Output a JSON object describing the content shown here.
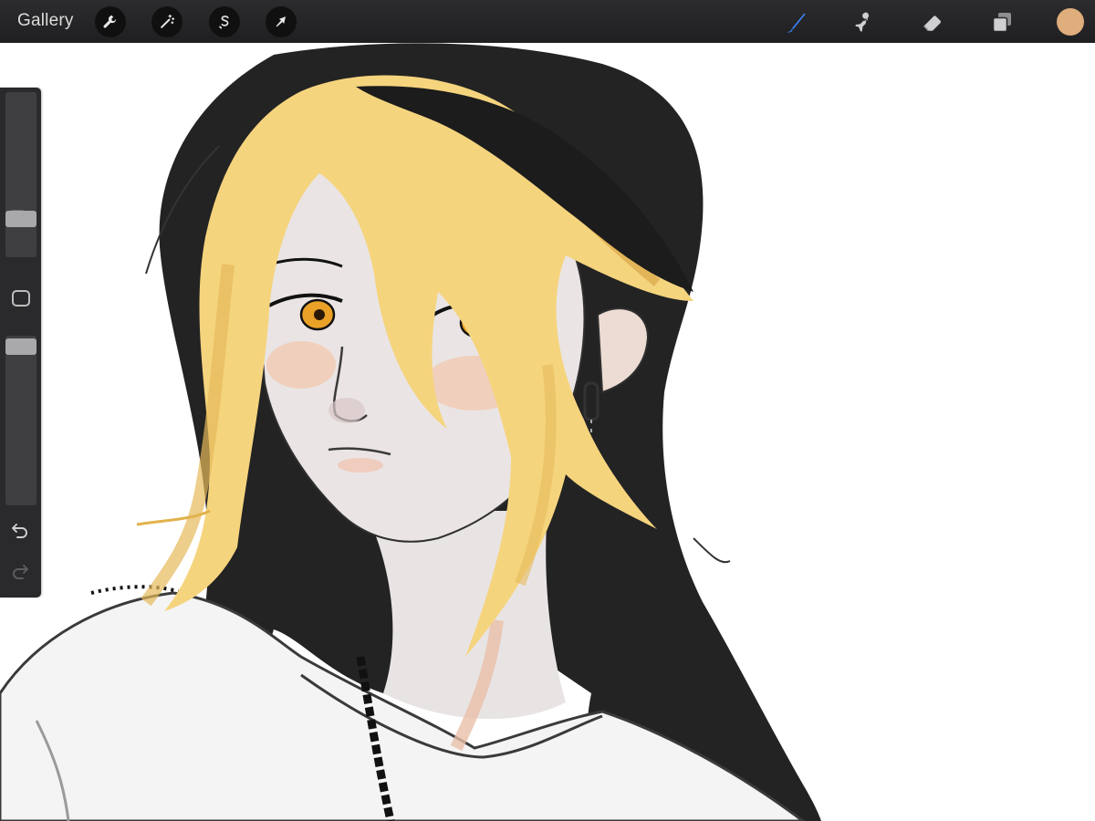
{
  "app": {
    "gallery_label": "Gallery"
  },
  "toolbar": {
    "left_tools": [
      {
        "icon": "wrench-icon",
        "name": "actions"
      },
      {
        "icon": "magic-wand-icon",
        "name": "adjustments"
      },
      {
        "icon": "selection-s-icon",
        "name": "selection"
      },
      {
        "icon": "transform-arrow-icon",
        "name": "transform"
      }
    ],
    "right_tools": [
      {
        "icon": "brush-icon",
        "name": "paint",
        "active": true
      },
      {
        "icon": "smudge-icon",
        "name": "smudge",
        "active": false
      },
      {
        "icon": "eraser-icon",
        "name": "eraser",
        "active": false
      },
      {
        "icon": "layers-icon",
        "name": "layers",
        "active": false
      }
    ],
    "current_color": "#E0AD7C",
    "active_color": "#3B82F6"
  },
  "sidebar": {
    "brush_size": 0.2,
    "opacity": 0.98,
    "icons": [
      "modify-square-icon",
      "undo-icon",
      "redo-icon"
    ]
  },
  "canvas": {
    "background": "#FFFFFF",
    "subject": "illustration"
  }
}
